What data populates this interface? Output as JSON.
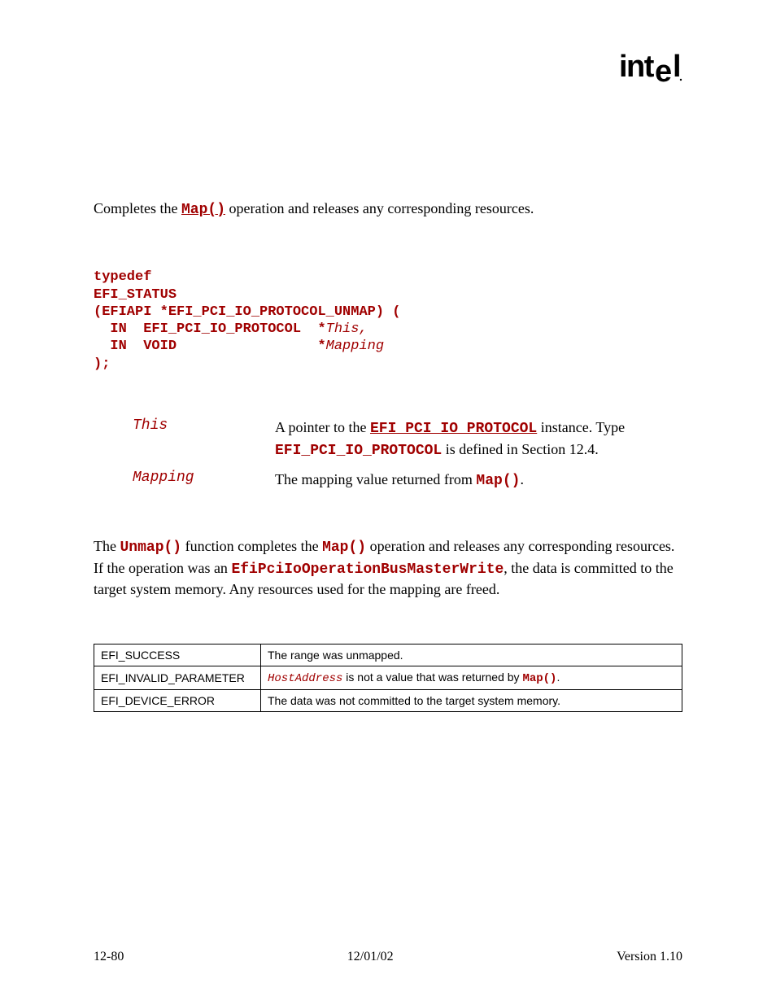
{
  "logo_alt": "intel",
  "summary": {
    "pre": "Completes the ",
    "link": "Map()",
    "post": " operation and releases any corresponding resources."
  },
  "prototype": {
    "line1": "typedef",
    "line2": "EFI_STATUS",
    "line3": "(EFIAPI *EFI_PCI_IO_PROTOCOL_UNMAP) (",
    "line4a": "  IN  EFI_PCI_IO_PROTOCOL  *",
    "line4b": "This,",
    "line5a": "  IN  VOID                 *",
    "line5b": "Mapping",
    "line6": ");"
  },
  "params": [
    {
      "name": "This",
      "d1": "A pointer to the ",
      "d2": "EFI_PCI_IO_PROTOCOL",
      "d3": " instance.  Type ",
      "d4": "EFI_PCI_IO_PROTOCOL",
      "d5": " is defined in Section 12.4."
    },
    {
      "name": "Mapping",
      "d1": "The mapping value returned from ",
      "d2": "Map()",
      "d3": "."
    }
  ],
  "description": {
    "p1": "The ",
    "p2": "Unmap()",
    "p3": " function completes the ",
    "p4": "Map()",
    "p5": " operation and releases any corresponding resources. If the operation was an ",
    "p6": "EfiPciIoOperationBusMasterWrite",
    "p7": ", the data is committed to the target system memory.  Any resources used for the mapping are freed."
  },
  "status_table": [
    {
      "code": "EFI_SUCCESS",
      "d1": "The range was unmapped."
    },
    {
      "code": "EFI_INVALID_PARAMETER",
      "d1a": "HostAddress",
      "d1b": " is not a value that was returned by ",
      "d1c": "Map()",
      "d1d": "."
    },
    {
      "code": "EFI_DEVICE_ERROR",
      "d1": "The data was not committed to the target system memory."
    }
  ],
  "footer": {
    "left": "12-80",
    "center": "12/01/02",
    "right": "Version 1.10"
  }
}
